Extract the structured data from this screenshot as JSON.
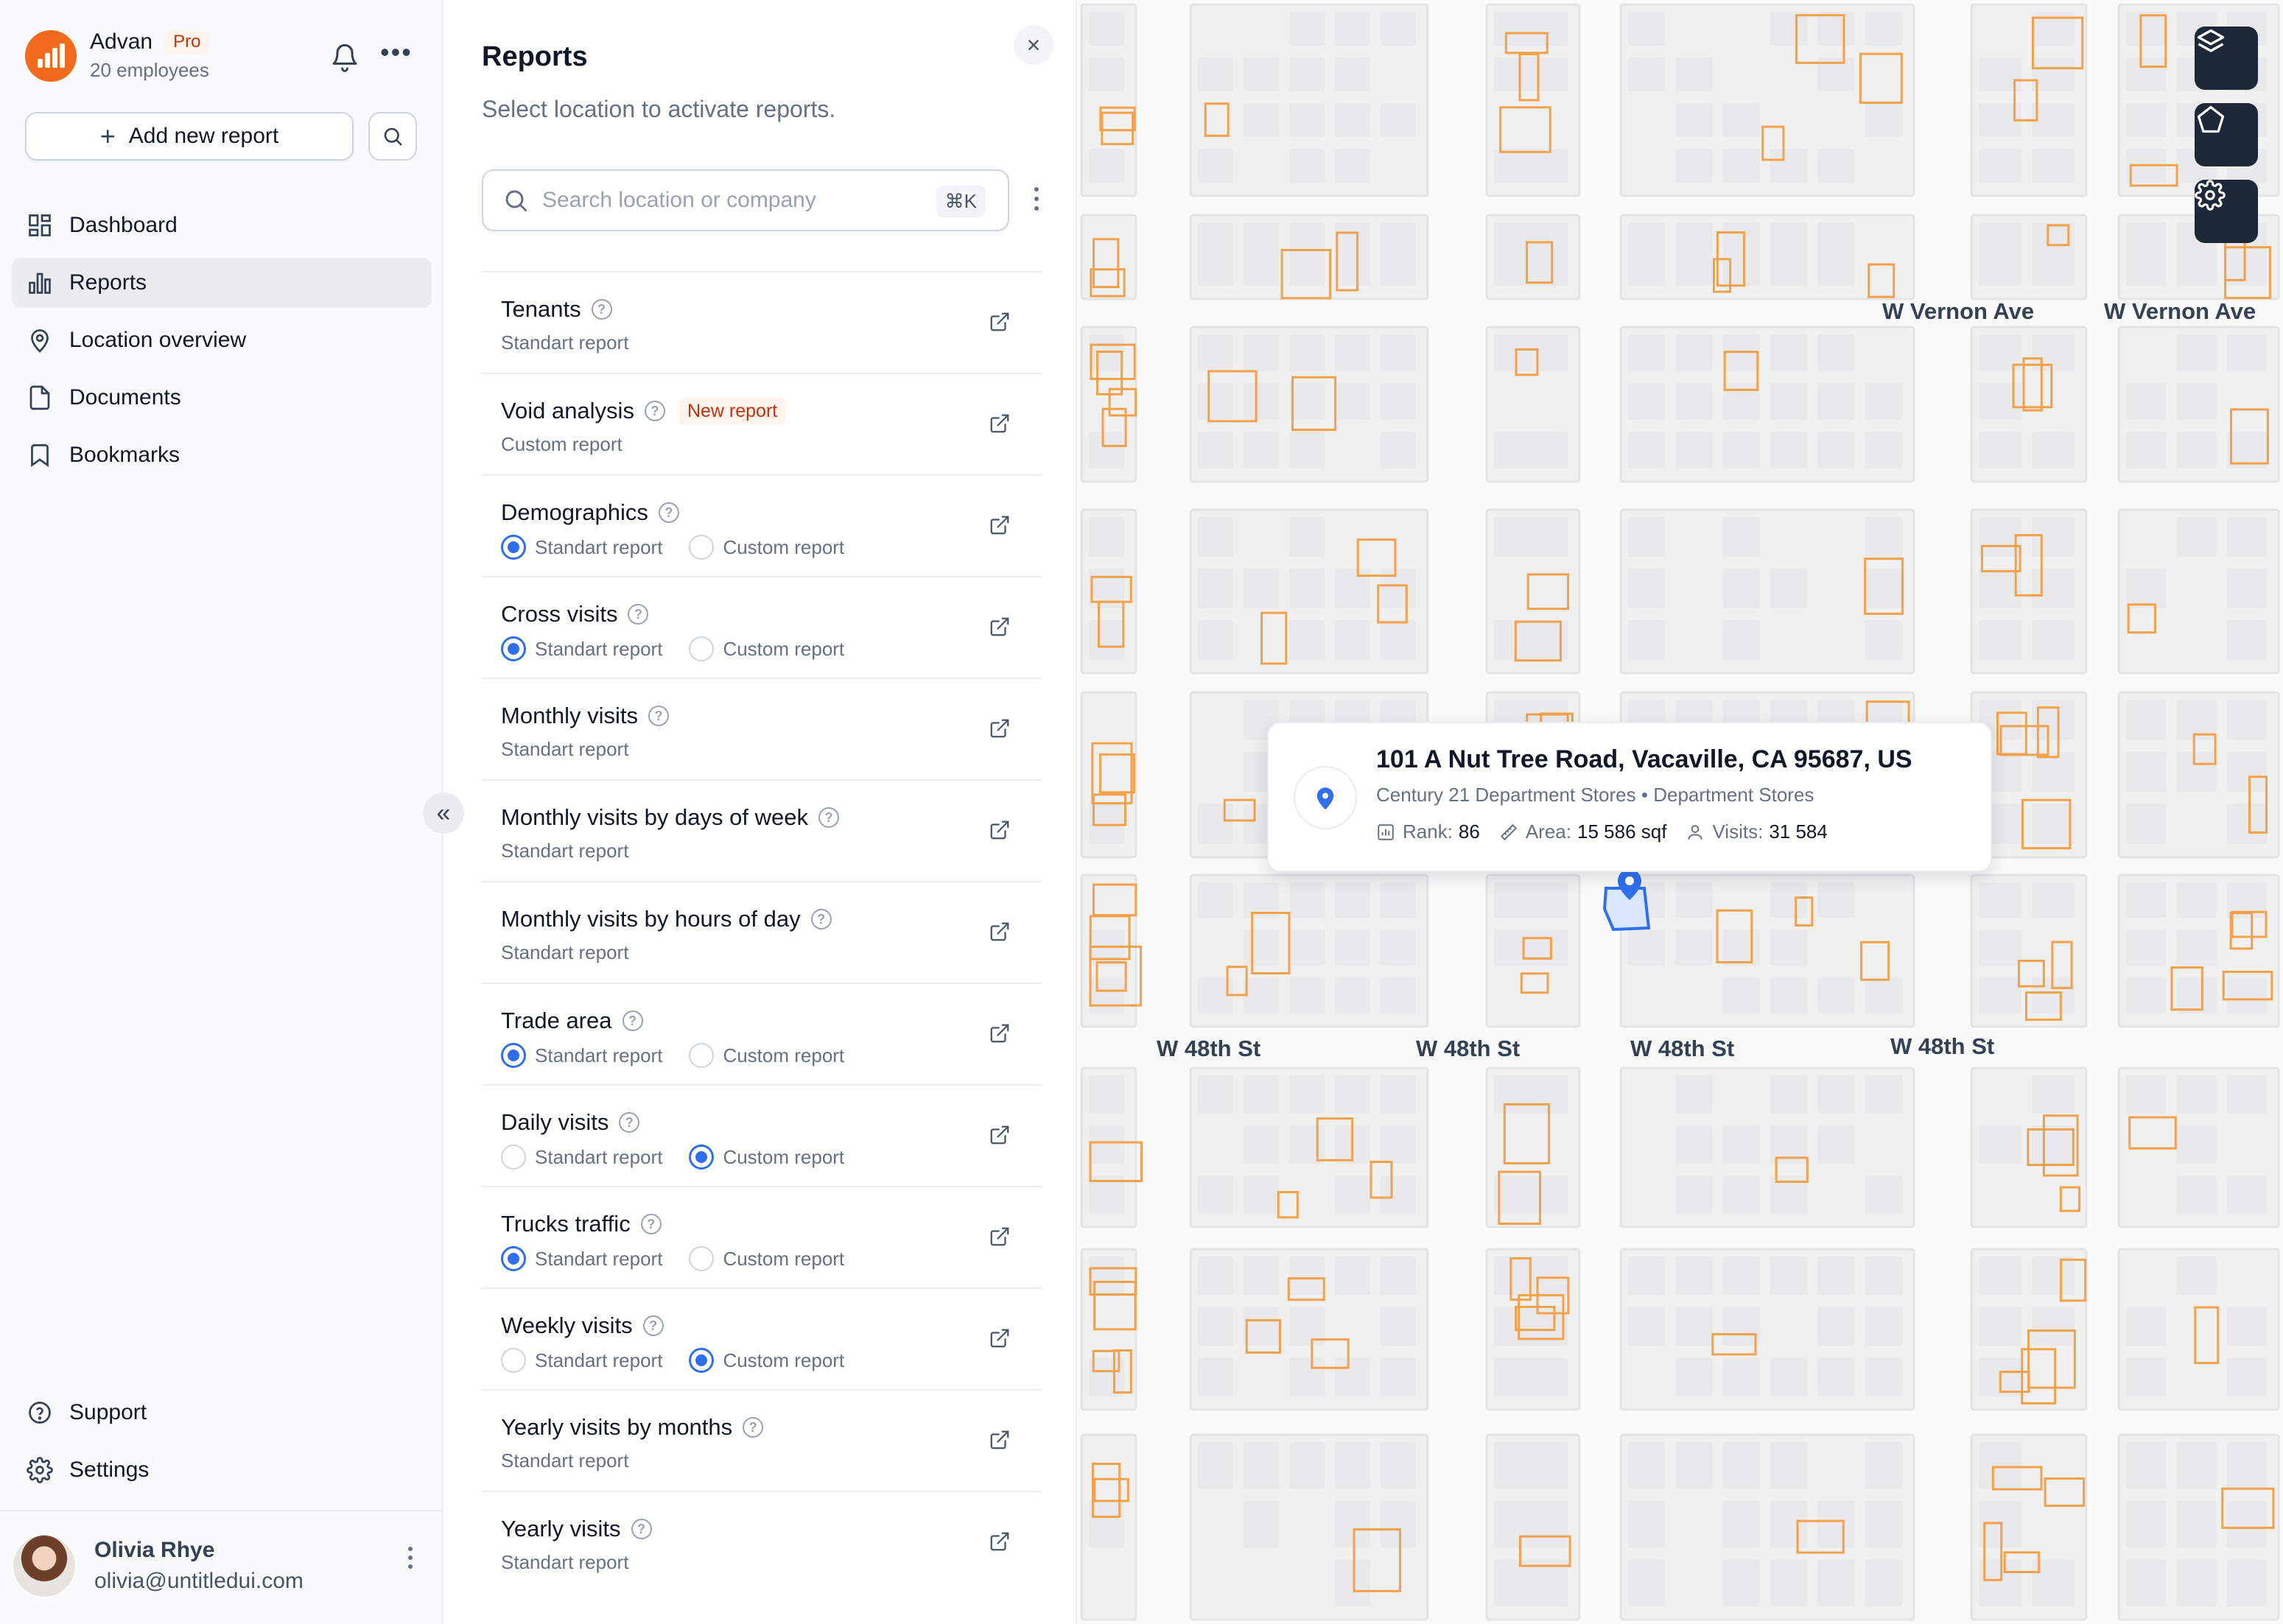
{
  "brand": {
    "name": "Advan",
    "plan_badge": "Pro",
    "subtitle": "20 employees",
    "accent_color": "#f26b1d"
  },
  "sidebar": {
    "add_button_label": "Add new report",
    "nav": [
      {
        "label": "Dashboard",
        "icon": "dashboard-icon",
        "active": false
      },
      {
        "label": "Reports",
        "icon": "bar-chart-icon",
        "active": true
      },
      {
        "label": "Location overview",
        "icon": "map-pin-icon",
        "active": false
      },
      {
        "label": "Documents",
        "icon": "file-icon",
        "active": false
      },
      {
        "label": "Bookmarks",
        "icon": "bookmark-icon",
        "active": false
      }
    ],
    "bottom_nav": [
      {
        "label": "Support",
        "icon": "help-circle-icon"
      },
      {
        "label": "Settings",
        "icon": "gear-icon"
      }
    ],
    "user": {
      "name": "Olivia Rhye",
      "email": "olivia@untitledui.com"
    }
  },
  "panel": {
    "title": "Reports",
    "subtitle": "Select location to activate reports.",
    "search_placeholder": "Search location or company",
    "search_shortcut": "⌘K",
    "option_standard": "Standart report",
    "option_custom": "Custom report",
    "reports": [
      {
        "title": "Tenants",
        "type": "static",
        "sub": "Standart report"
      },
      {
        "title": "Void analysis",
        "type": "static",
        "sub": "Custom report",
        "badge": "New report"
      },
      {
        "title": "Demographics",
        "type": "radio",
        "selected": "standard"
      },
      {
        "title": "Cross visits",
        "type": "radio",
        "selected": "standard"
      },
      {
        "title": "Monthly visits",
        "type": "static",
        "sub": "Standart report"
      },
      {
        "title": "Monthly visits by days of week",
        "type": "static",
        "sub": "Standart report"
      },
      {
        "title": "Monthly visits by hours of day",
        "type": "static",
        "sub": "Standart report"
      },
      {
        "title": "Trade area",
        "type": "radio",
        "selected": "standard"
      },
      {
        "title": "Daily visits",
        "type": "radio",
        "selected": "custom"
      },
      {
        "title": "Trucks traffic",
        "type": "radio",
        "selected": "standard"
      },
      {
        "title": "Weekly visits",
        "type": "radio",
        "selected": "custom"
      },
      {
        "title": "Yearly visits by months",
        "type": "static",
        "sub": "Standart report"
      },
      {
        "title": "Yearly visits",
        "type": "static",
        "sub": "Standart report"
      }
    ],
    "accent_color": "#2f6fed"
  },
  "map": {
    "streets": [
      "W Vernon Ave",
      "W Vernon Ave",
      "W 48th St",
      "W 48th St",
      "W 48th St",
      "W 48th St"
    ],
    "controls": [
      "layers-icon",
      "polygon-icon",
      "gear-icon"
    ],
    "building_color": "#f5a04a",
    "popup": {
      "title": "101 A Nut Tree Road, Vacaville, CA 95687, US",
      "company": "Century 21 Department Stores",
      "category": "Department Stores",
      "separator": "•",
      "rank_label": "Rank:",
      "rank_value": "86",
      "area_label": "Area:",
      "area_value": "15 586 sqf",
      "visits_label": "Visits:",
      "visits_value": "31 584"
    }
  }
}
